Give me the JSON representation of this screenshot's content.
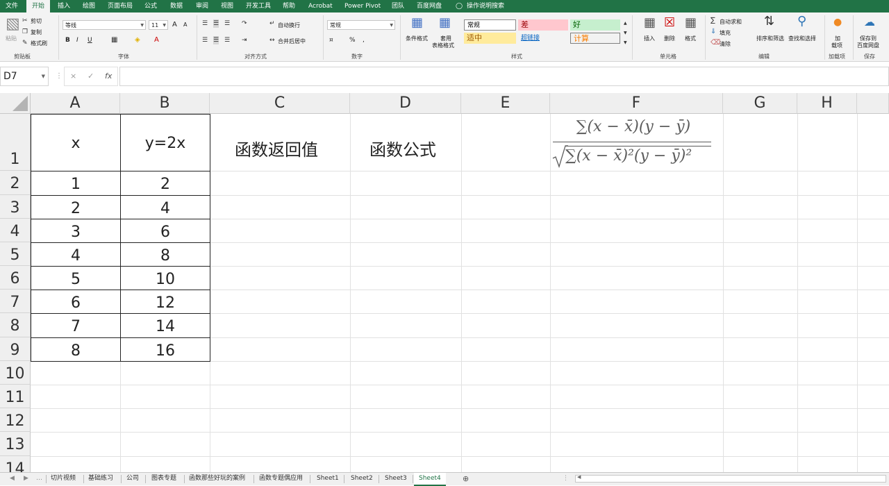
{
  "menu_tabs": [
    "文件",
    "开始",
    "插入",
    "绘图",
    "页面布局",
    "公式",
    "数据",
    "审阅",
    "视图",
    "开发工具",
    "帮助",
    "Acrobat",
    "Power Pivot",
    "团队",
    "百度网盘",
    "操作说明搜索"
  ],
  "ribbon": {
    "clipboard": {
      "paste": "粘贴",
      "cut": "剪切",
      "copy": "复制",
      "format_painter": "格式刷",
      "label": "剪贴板"
    },
    "font": {
      "name": "等线",
      "size": "11",
      "label": "字体",
      "bold": "B",
      "italic": "I",
      "underline": "U",
      "grow": "A",
      "shrink": "A"
    },
    "alignment": {
      "wrap": "自动换行",
      "merge": "合并后居中",
      "label": "对齐方式"
    },
    "number": {
      "format": "常规",
      "percent": "%",
      "comma": ",",
      "label": "数字"
    },
    "styles": {
      "conditional": "条件格式",
      "table1": "套用",
      "table2": "表格格式",
      "normal": "常规",
      "bad": "差",
      "good": "好",
      "neutral": "适中",
      "hyperlink": "超链接",
      "calc": "计算",
      "label": "样式"
    },
    "cells": {
      "insert": "插入",
      "delete": "删除",
      "format": "格式",
      "label": "单元格"
    },
    "editing": {
      "autosum": "自动求和",
      "fill": "填充",
      "clear": "清除",
      "sort": "排序和筛选",
      "find": "查找和选择",
      "label": "编辑"
    },
    "addins": {
      "addin1": "加",
      "addin2": "载项",
      "label": "加载项"
    },
    "save": {
      "btn1": "保存到",
      "btn2": "百度网盘",
      "label": "保存"
    }
  },
  "formula_bar": {
    "namebox": "D7",
    "cancel": "×",
    "confirm": "✓",
    "fx": "fx",
    "formula": ""
  },
  "columns": [
    "A",
    "B",
    "C",
    "D",
    "E",
    "F",
    "G",
    "H"
  ],
  "rows": [
    "1",
    "2",
    "3",
    "4",
    "5",
    "6",
    "7",
    "8",
    "9",
    "10",
    "11",
    "12",
    "13",
    "14"
  ],
  "table": {
    "headers": [
      "x",
      "y=2x"
    ],
    "rows": [
      [
        "1",
        "2"
      ],
      [
        "2",
        "4"
      ],
      [
        "3",
        "6"
      ],
      [
        "4",
        "8"
      ],
      [
        "5",
        "10"
      ],
      [
        "6",
        "12"
      ],
      [
        "7",
        "14"
      ],
      [
        "8",
        "16"
      ]
    ]
  },
  "c1": "函数返回值",
  "d1": "函数公式",
  "formula_image": {
    "numerator": "∑(x − x̄)(y − ȳ)",
    "denominator": "∑(x − x̄)²(y − ȳ)²"
  },
  "sheet_tabs": [
    "切片视频",
    "基础练习",
    "公司",
    "图表专题",
    "函数那些好玩的案例",
    "函数专题偶应用",
    "Sheet1",
    "Sheet2",
    "Sheet3",
    "Sheet4"
  ],
  "active_sheet": "Sheet4",
  "colors": {
    "brand": "#217346",
    "bad_bg": "#ffc7ce",
    "good_bg": "#c6efce",
    "neutral_bg": "#ffeb9c",
    "calc_color": "#fa7d00"
  }
}
